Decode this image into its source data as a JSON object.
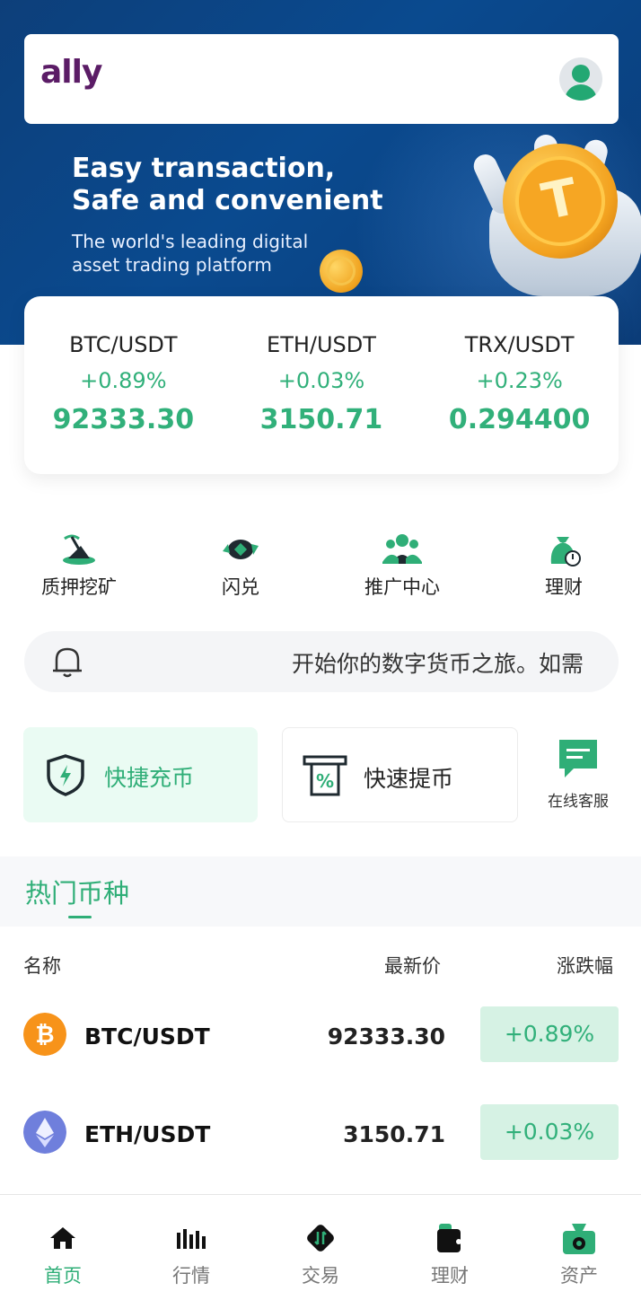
{
  "header": {
    "logo_text": "ally",
    "avatar_icon": "user-icon"
  },
  "banner": {
    "title": "Easy transaction, Safe and convenient",
    "subtitle": "The world's leading digital asset trading platform"
  },
  "tickers": [
    {
      "pair": "BTC/USDT",
      "change": "+0.89%",
      "price": "92333.30"
    },
    {
      "pair": "ETH/USDT",
      "change": "+0.03%",
      "price": "3150.71"
    },
    {
      "pair": "TRX/USDT",
      "change": "+0.23%",
      "price": "0.294400"
    }
  ],
  "menu": [
    {
      "label": "质押挖矿",
      "icon": "mining-icon"
    },
    {
      "label": "闪兑",
      "icon": "flash-swap-icon"
    },
    {
      "label": "推广中心",
      "icon": "referral-icon"
    },
    {
      "label": "理财",
      "icon": "money-bag-icon"
    }
  ],
  "notice": {
    "icon": "bell-icon",
    "text": "开始你的数字货币之旅。如需"
  },
  "actions": {
    "deposit_label": "快捷充币",
    "withdraw_label": "快速提币",
    "service_label": "在线客服"
  },
  "hot": {
    "title": "热门币种",
    "columns": {
      "name": "名称",
      "price": "最新价",
      "change": "涨跌幅"
    },
    "rows": [
      {
        "name": "BTC/USDT",
        "price": "92333.30",
        "change": "+0.89%",
        "icon": "bitcoin-icon"
      },
      {
        "name": "ETH/USDT",
        "price": "3150.71",
        "change": "+0.03%",
        "icon": "ethereum-icon"
      }
    ]
  },
  "tabbar": [
    {
      "label": "首页",
      "icon": "home-icon",
      "active": true
    },
    {
      "label": "行情",
      "icon": "market-chart-icon",
      "active": false
    },
    {
      "label": "交易",
      "icon": "trade-icon",
      "active": false
    },
    {
      "label": "理财",
      "icon": "wallet-icon",
      "active": false
    },
    {
      "label": "资产",
      "icon": "assets-icon",
      "active": false
    }
  ],
  "colors": {
    "accent": "#2fae77",
    "up": "#31b07a",
    "banner_bg": "#0b4385",
    "brand_logo": "#5b1c66"
  }
}
